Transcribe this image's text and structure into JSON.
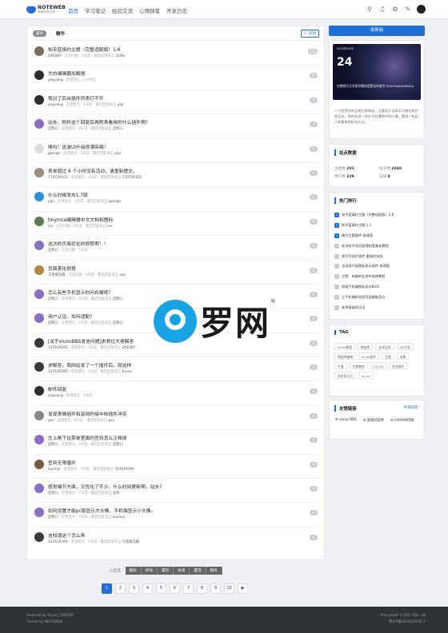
{
  "header": {
    "logo_main": "NOTEWEB",
    "logo_sub": "养极风的记录",
    "nav": [
      "首页",
      "学习笔记",
      "经验交流",
      "心情随笔",
      "开发日志"
    ]
  },
  "list": {
    "new_tab": "最新",
    "ess_tab": "精华",
    "sign": "签到",
    "threads": [
      {
        "title": "知乎蓝填约主题（完整适配版）1.6",
        "user": "ZAESKY",
        "meta": "· 交流问题 · 2天前 · 最后回复来自",
        "last": "chiflu",
        "count": "120",
        "color": "#7a6b5d"
      },
      {
        "title": "大白编辑器加载慢",
        "user": "yeguang",
        "meta": "· 反馈意见 · 5小时前",
        "last": "",
        "count": "0",
        "color": "#2d2d2d"
      },
      {
        "title": "我对了后台插件列表打不开",
        "user": "yeguang",
        "meta": "· 反馈意见 · 2天前 · 最后回复来自",
        "last": "pipi",
        "count": "0",
        "color": "#2d2d2d"
      },
      {
        "title": "站长，附件这个回复后再附表看用的什么插件啊?",
        "user": "启辉儿",
        "meta": "· 反馈意见 · 2天前 · 最后回复来自",
        "last": "启辉儿",
        "count": "3",
        "color": "#8a6ec7"
      },
      {
        "title": "咦吗！这波UI升级很漂亮哦！",
        "user": "george",
        "meta": "· 反馈意见 · 3天前 · 最后回复来自",
        "last": "pipi",
        "count": "0",
        "color": "#dcdde2"
      },
      {
        "title": "表单超过 6 个小时没有活动，请重新提交。",
        "user": "770720101",
        "meta": "· 反馈意见 · 3天前 · 最后回复来自",
        "last": "770720101",
        "count": "0",
        "color": "#9a8f86"
      },
      {
        "title": "什么时候发布1.7版",
        "user": "pipi",
        "meta": "· 反馈意见 · 4天前 · 最后回复来自",
        "last": "george",
        "count": "2",
        "color": "#2a8fe0"
      },
      {
        "title": "tinymce编辑器中文文档和图标",
        "user": "ins",
        "meta": "· 交流问题 · 5天前 · 最后回复来自",
        "last": "ins",
        "count": "0",
        "color": "#5e7a52"
      },
      {
        "title": "这次的页面优化的很赞啊！！",
        "user": "启辉儿",
        "meta": "· 交流问题 · 5天前",
        "last": "",
        "count": "0",
        "color": "#8a6ec7"
      },
      {
        "title": "页面美化很搭",
        "user": "马里奥先森",
        "meta": "· 交流问题 · 6天前 · 最后回复来自",
        "last": "pipi",
        "count": "0",
        "color": "#b5863f"
      },
      {
        "title": "怎么有些手机显示的问右偏呢?",
        "user": "启辉儿",
        "meta": "· 反馈意见 · 6天前 · 最后回复来自",
        "last": "启辉儿",
        "count": "0",
        "color": "#8a6ec7"
      },
      {
        "title": "用户认证。如何适配?",
        "user": "启辉儿",
        "meta": "· 反馈意见 · 6天前 · 最后回复来自",
        "last": "启辉儿",
        "count": "0",
        "color": "#8a6ec7"
      },
      {
        "title": "[关于xiunoBBS发信问题]求救位大佬解答",
        "user": "337619395",
        "meta": "· 反馈意见 · 6天前 · 最后回复来自",
        "last": "ZAESKY",
        "count": "0",
        "color": "#3a3a3a"
      },
      {
        "title": "求解答，我网站发了一个插件后，就这样",
        "user": "337619395",
        "meta": "· 反馈意见 · 6天前 · 最后回复来自",
        "last": "bruce",
        "count": "0",
        "color": "#3a3a3a"
      },
      {
        "title": "邮件回复",
        "user": "yeguang",
        "meta": "· 反馈意见 · 6天前",
        "last": "",
        "count": "0",
        "color": "#2d2d2d"
      },
      {
        "title": "发现表情插件和音网的接中核插件冲突",
        "user": "gsv",
        "meta": "· 反馈意见 · 6天前 · 最后回复来自",
        "last": "gsv",
        "count": "0",
        "color": "#888"
      },
      {
        "title": "左上角下拉菜单里面的签到怎么注释掉",
        "user": "启辉儿",
        "meta": "· 反馈意见 · 6天前 · 最后回复来自",
        "last": "启辉儿",
        "count": "0",
        "color": "#8a6ec7"
      },
      {
        "title": "签到无限循环",
        "user": "kaxinyi",
        "meta": "· 反馈意见 · 7天前 · 最后回复来自",
        "last": "337619395",
        "count": "0",
        "color": "#7a5a3a"
      },
      {
        "title": "感觉细节方面，又优化了不少，什么时间更新啊，站长?",
        "user": "启辉儿",
        "meta": "· 反馈意见 · 7天前 · 最后回复来自",
        "last": "没有",
        "count": "0",
        "color": "#8a6ec7"
      },
      {
        "title": "如何设置才能pc版显示大头像，手机端显示小头像。",
        "user": "启辉儿",
        "meta": "· 反馈意见 · 7天前 · 最后回复来自",
        "last": "kaxinyi",
        "count": "0",
        "color": "#8a6ec7"
      },
      {
        "title": "这知道这个怎么弄",
        "user": "337619395",
        "meta": "· 反馈意见 · 7天前 · 最后回复来自",
        "last": "马里奥先森",
        "count": "0",
        "color": "#3a3a3a"
      }
    ]
  },
  "mod": {
    "all": "全选",
    "buttons": [
      "删除",
      "移动",
      "置顶",
      "关闭",
      "置顶",
      "精华"
    ]
  },
  "pager": [
    "1",
    "2",
    "3",
    "4",
    "5",
    "6",
    "7",
    "8",
    "9",
    "10",
    "▶"
  ],
  "side": {
    "post_btn": "发新帖",
    "promo": {
      "date": "2020年04月",
      "day": "24",
      "caption": "在晚想天文学家你看的是更远的星空 ESA/Hubble/NASA",
      "text": "一个程序员的日常记录网站，主要用于记录学习笔记和开发日志，同时分享一些在平时遇到中的心情，提供一些自己收集来的好站方法。"
    },
    "stats": {
      "title": "站点数据",
      "topics_label": "主题数",
      "topics": "201",
      "posts_label": "帖子数",
      "posts": "2048",
      "users_label": "用户数",
      "users": "329",
      "online_label": "在线",
      "online": "8"
    },
    "hot": {
      "title": "热门排行",
      "items": [
        "知乎蓝填约主题（完整适配版）1.6",
        "知乎蓝填约主题 1.1",
        "精华主题插件 修改版",
        "帖详帖子间页面限制宽美化教程",
        "更灯号帖栏插件 重制优化版",
        "全局用户组图标显示插件 修改版",
        "点赞、有趣的社发布修改教程",
        "修复手机端图标显示BUG",
        "让手机端的消息页面都能显示",
        "安卓基础知识点"
      ]
    },
    "tags": {
      "title": "TAG",
      "items": [
        "xiuno教程",
        "数据库",
        "安卓开发",
        "JSP开发",
        "数据库编辑",
        "xiuno插件",
        "主题",
        "采集",
        "牛逼",
        "切换教程",
        "11218",
        "签到插件",
        "安卓知识点",
        "xiuno"
      ]
    },
    "links": {
      "title": "友情链接",
      "apply": "申请友链",
      "items": [
        "xiuno BBS",
        "发现好软件",
        "CHARM印帆"
      ]
    }
  },
  "footer": {
    "left1": "Powered by Xiuno | ZAESKY",
    "left2": "Theme by NOTEWEB",
    "right1": "Processed: 0.265, SQL: 28",
    "right2": "粤ICP备20004201号-1"
  },
  "watermark": {
    "text": "罗网",
    "reg": "®"
  }
}
